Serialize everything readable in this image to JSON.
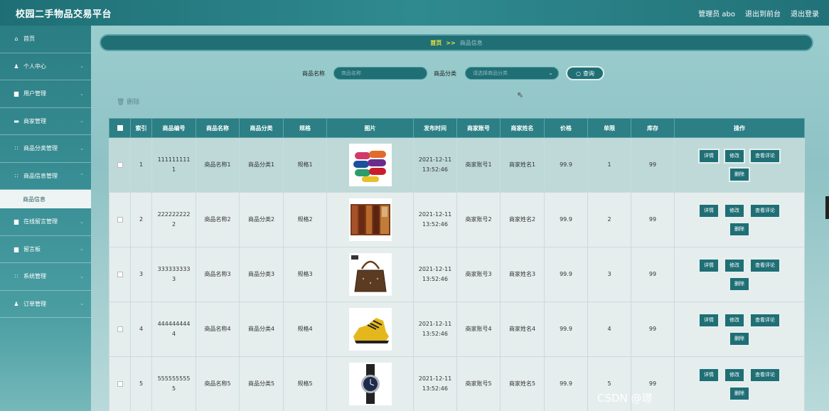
{
  "header": {
    "app_title": "校园二手物品交易平台",
    "user_label": "管理员 abo",
    "front_label": "退出到前台",
    "logout_label": "退出登录"
  },
  "sidebar": {
    "items": [
      {
        "label": "首页",
        "icon": "home-icon",
        "glyph": "⌂",
        "chevron": false
      },
      {
        "label": "个人中心",
        "icon": "user-icon",
        "glyph": "♟",
        "chevron": true
      },
      {
        "label": "用户管理",
        "icon": "doc-icon",
        "glyph": "▆",
        "chevron": true
      },
      {
        "label": "商家管理",
        "icon": "card-icon",
        "glyph": "▬",
        "chevron": true
      },
      {
        "label": "商品分类管理",
        "icon": "grid-icon",
        "glyph": "∷",
        "chevron": true
      },
      {
        "label": "商品信息管理",
        "icon": "grid-icon",
        "glyph": "∷",
        "chevron": true
      },
      {
        "label": "在线留言管理",
        "icon": "doc-icon",
        "glyph": "▆",
        "chevron": true
      },
      {
        "label": "留言板",
        "icon": "doc-icon",
        "glyph": "▆",
        "chevron": true
      },
      {
        "label": "系统管理",
        "icon": "grid-icon",
        "glyph": "∷",
        "chevron": true
      },
      {
        "label": "订单管理",
        "icon": "user-icon",
        "glyph": "♟",
        "chevron": true
      }
    ],
    "sub_item": "商品信息"
  },
  "breadcrumb": {
    "home": "首页",
    "sep": ">>",
    "current": "商品信息"
  },
  "search": {
    "name_label": "商品名称",
    "name_placeholder": "商品名称",
    "category_label": "商品分类",
    "category_placeholder": "请选择商品分类",
    "button_label": "查询"
  },
  "delete_label": "删除",
  "table": {
    "headers": [
      "",
      "索引",
      "商品编号",
      "商品名称",
      "商品分类",
      "规格",
      "图片",
      "发布时间",
      "商家账号",
      "商家姓名",
      "价格",
      "单限",
      "库存",
      "操作"
    ],
    "rows": [
      {
        "index": "1",
        "code": "1111111111",
        "name": "商品名称1",
        "category": "商品分类1",
        "spec": "规格1",
        "image": "yoga-mats",
        "date": "2021-12-11",
        "time": "13:52:46",
        "account": "商家账号1",
        "merchant": "商家姓名1",
        "price": "99.9",
        "limit": "1",
        "stock": "99"
      },
      {
        "index": "2",
        "code": "2222222222",
        "name": "商品名称2",
        "category": "商品分类2",
        "spec": "规格2",
        "image": "books",
        "date": "2021-12-11",
        "time": "13:52:46",
        "account": "商家账号2",
        "merchant": "商家姓名2",
        "price": "99.9",
        "limit": "2",
        "stock": "99"
      },
      {
        "index": "3",
        "code": "3333333333",
        "name": "商品名称3",
        "category": "商品分类3",
        "spec": "规格3",
        "image": "handbag",
        "date": "2021-12-11",
        "time": "13:52:46",
        "account": "商家账号3",
        "merchant": "商家姓名3",
        "price": "99.9",
        "limit": "3",
        "stock": "99"
      },
      {
        "index": "4",
        "code": "4444444444",
        "name": "商品名称4",
        "category": "商品分类4",
        "spec": "规格4",
        "image": "sneaker",
        "date": "2021-12-11",
        "time": "13:52:46",
        "account": "商家账号4",
        "merchant": "商家姓名4",
        "price": "99.9",
        "limit": "4",
        "stock": "99"
      },
      {
        "index": "5",
        "code": "5555555555",
        "name": "商品名称5",
        "category": "商品分类5",
        "spec": "规格5",
        "image": "wristwatch",
        "date": "2021-12-11",
        "time": "13:52:46",
        "account": "商家账号5",
        "merchant": "商家姓名5",
        "price": "99.9",
        "limit": "5",
        "stock": "99"
      }
    ],
    "actions": {
      "detail": "详情",
      "edit": "修改",
      "reviews": "查看评论",
      "delete": "删除"
    }
  },
  "watermark": "CSDN @璟",
  "colors": {
    "primary": "#1f6f75",
    "header": "#2b7f85",
    "accent": "#f2e23a"
  }
}
